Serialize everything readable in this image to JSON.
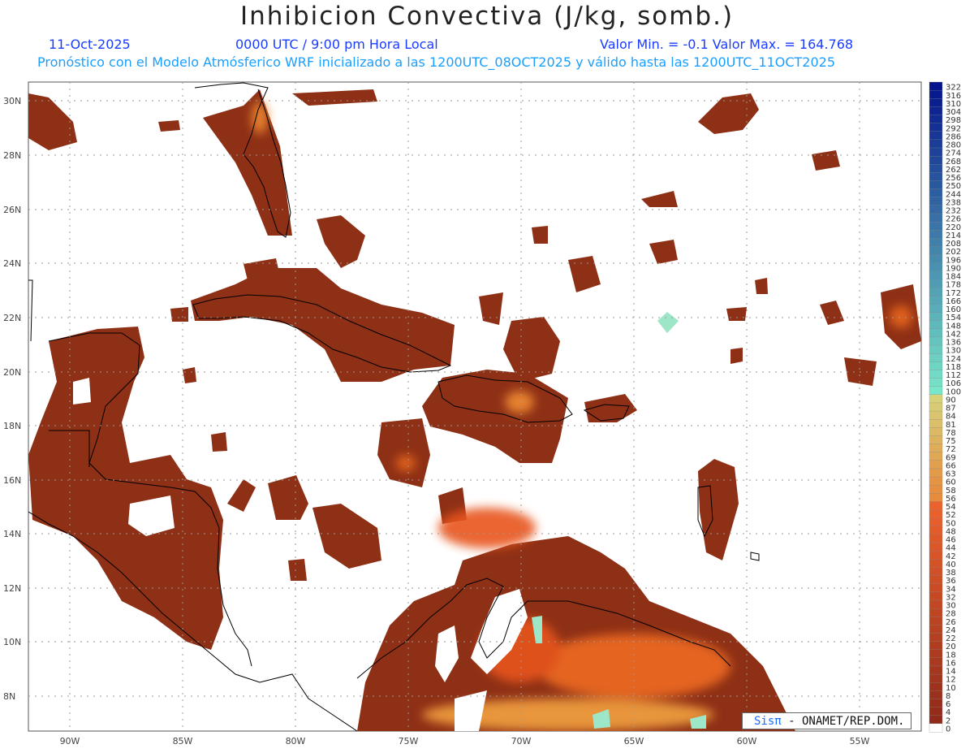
{
  "header": {
    "title": "Inhibicion Convectiva (J/kg, somb.)",
    "date": "11-Oct-2025",
    "valid_time": "0000 UTC / 9:00 pm Hora Local",
    "min_max": "Valor Min. = -0.1  Valor Max. = 164.768",
    "model_line": "Pronóstico con el Modelo Atmósferico WRF inicializado a las 1200UTC_08OCT2025 y válido hasta las  1200UTC_11OCT2025"
  },
  "map": {
    "lat_labels": [
      "30N",
      "28N",
      "26N",
      "24N",
      "22N",
      "20N",
      "18N",
      "16N",
      "14N",
      "12N",
      "10N",
      "8N"
    ],
    "lon_labels": [
      "90W",
      "85W",
      "80W",
      "75W",
      "70W",
      "65W",
      "60W",
      "55W"
    ],
    "colors": {
      "fill_dark": "#8a2e17",
      "fill_mid": "#a8401d",
      "fill_bright": "#e8541a",
      "fill_hot": "#f2a040",
      "fill_cool": "#9ee6c8",
      "coast": "#000000",
      "grid": "#9a9a9a"
    }
  },
  "colorbar": {
    "labels": [
      "322",
      "316",
      "310",
      "304",
      "298",
      "292",
      "286",
      "280",
      "274",
      "268",
      "262",
      "256",
      "250",
      "244",
      "238",
      "232",
      "226",
      "220",
      "214",
      "208",
      "202",
      "196",
      "190",
      "184",
      "178",
      "172",
      "166",
      "160",
      "154",
      "148",
      "142",
      "136",
      "130",
      "124",
      "118",
      "112",
      "106",
      "100",
      "90",
      "87",
      "84",
      "81",
      "78",
      "75",
      "72",
      "69",
      "66",
      "63",
      "60",
      "58",
      "56",
      "54",
      "52",
      "50",
      "48",
      "46",
      "44",
      "42",
      "40",
      "38",
      "36",
      "34",
      "32",
      "30",
      "28",
      "26",
      "24",
      "22",
      "20",
      "18",
      "16",
      "14",
      "12",
      "10",
      "8",
      "6",
      "4",
      "2",
      "0"
    ]
  },
  "credit": {
    "brand": "Sisπ",
    "text": " - ONAMET/REP.DOM."
  }
}
